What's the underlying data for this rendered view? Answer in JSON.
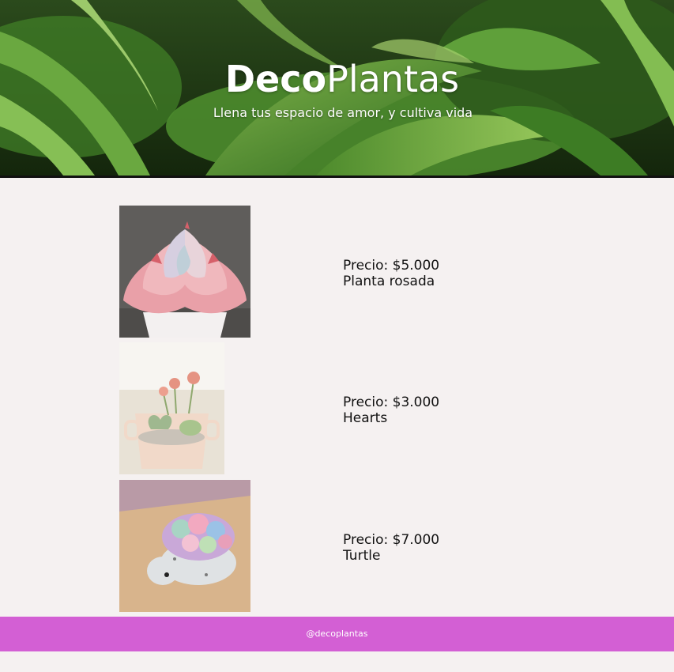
{
  "header": {
    "title_bold": "Deco",
    "title_light": "Plantas",
    "subtitle": "Llena tus espacio de amor, y cultiva vida"
  },
  "products": [
    {
      "price": "Precio: $5.000",
      "name": "Planta rosada",
      "image": "pink-succulent-photo"
    },
    {
      "price": "Precio: $3.000",
      "name": "Hearts",
      "image": "heart-succulent-pot-photo"
    },
    {
      "price": "Precio: $7.000",
      "name": "Turtle",
      "image": "succulent-turtle-photo"
    }
  ],
  "footer": {
    "handle": "@decoplantas"
  },
  "colors": {
    "page_background": "#f5f1f1",
    "footer_background": "#d35fd4",
    "header_text": "#ffffff",
    "product_text": "#111111"
  }
}
